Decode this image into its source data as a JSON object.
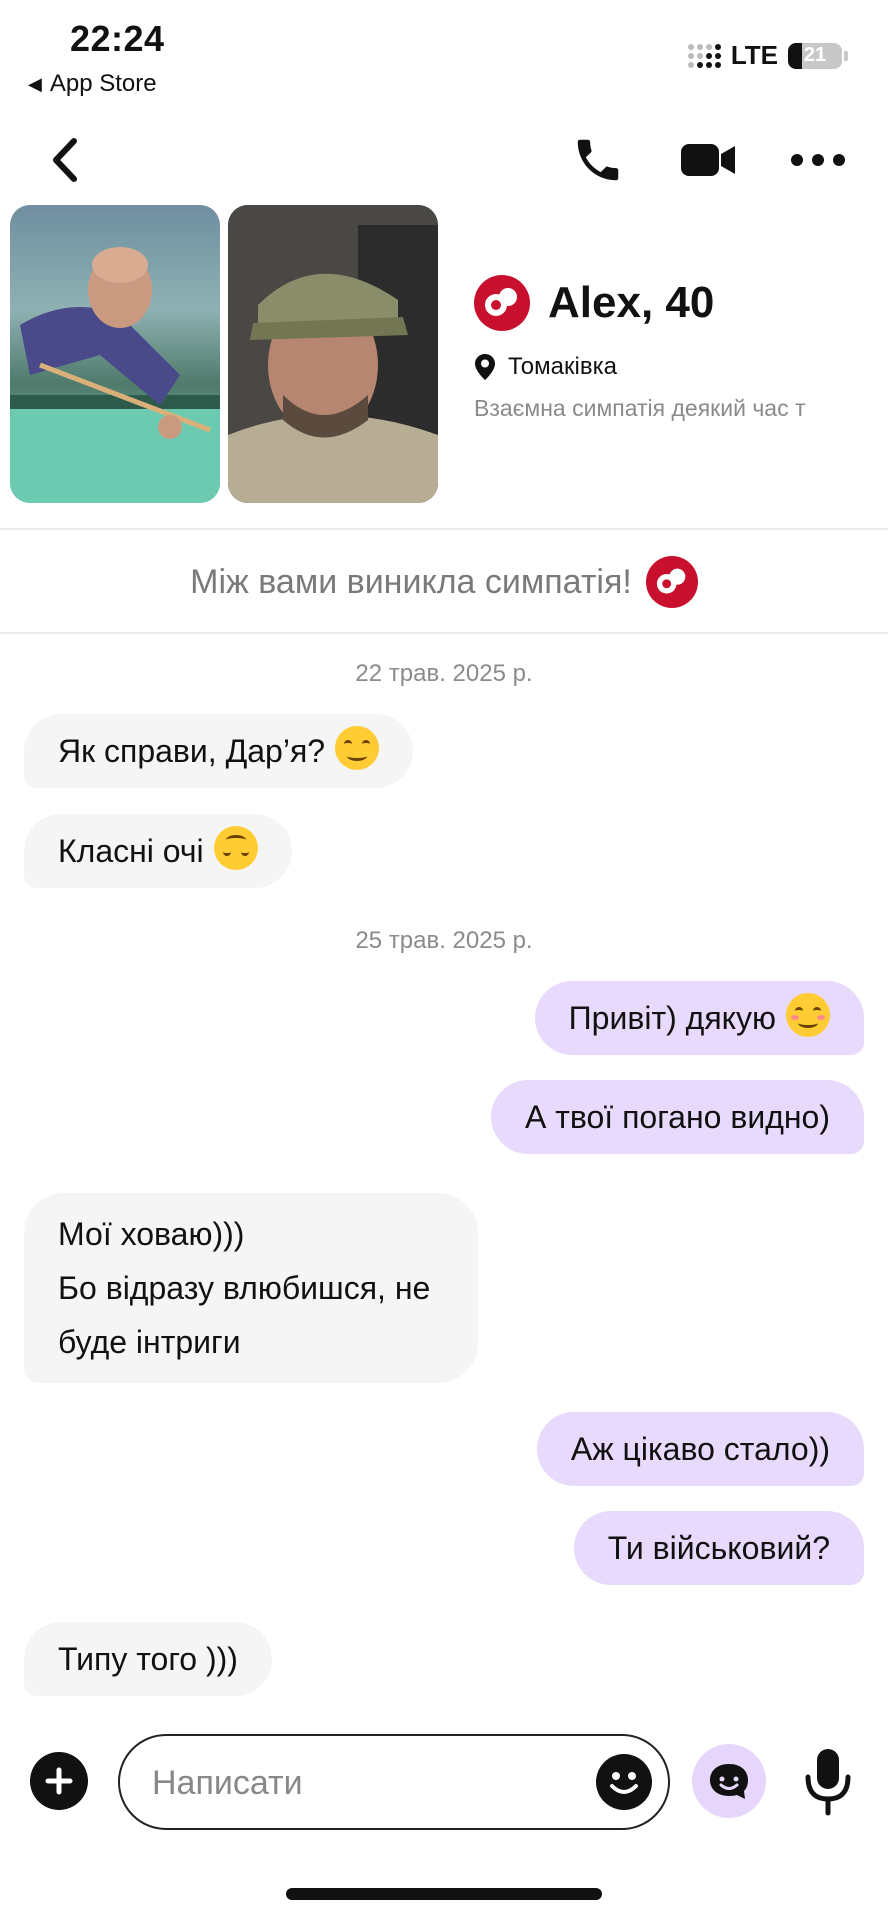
{
  "status_bar": {
    "time": "22:24",
    "back_app": "App Store",
    "network": "LTE",
    "battery": "21"
  },
  "nav": {
    "icons": [
      "back-chevron-icon",
      "phone-icon",
      "video-camera-icon",
      "more-dots-icon"
    ]
  },
  "profile": {
    "name": "Alex, 40",
    "location": "Томаківка",
    "mutual": "Взаємна симпатія деякий час т",
    "photos": [
      "profile-photo-billiards",
      "profile-photo-military-cap"
    ]
  },
  "match_banner": "Між вами виникла симпатія!",
  "messages": [
    {
      "type": "date",
      "text": "22 трав. 2025 р."
    },
    {
      "type": "in",
      "text": "Як справи, Дар’я?",
      "emoji": "smiling-face"
    },
    {
      "type": "in",
      "text": "Класні очі",
      "emoji": "upside-down-face"
    },
    {
      "type": "date",
      "text": "25 трав. 2025 р."
    },
    {
      "type": "out",
      "text": "Привіт) дякую",
      "emoji": "smiling-face-blush"
    },
    {
      "type": "out",
      "text": "А твої погано видно)"
    },
    {
      "type": "in",
      "lines": [
        "Мої ховаю)))",
        "Бо відразу влюбишся, не",
        "буде інтриги"
      ]
    },
    {
      "type": "out",
      "text": "Аж цікаво стало))"
    },
    {
      "type": "out",
      "text": "Ти військовий?"
    },
    {
      "type": "in",
      "text": "Типу того )))"
    }
  ],
  "composer": {
    "placeholder": "Написати"
  },
  "colors": {
    "brand": "#c8102e",
    "outgoing_bubble": "#e8dafc",
    "incoming_bubble": "#f5f5f5"
  }
}
